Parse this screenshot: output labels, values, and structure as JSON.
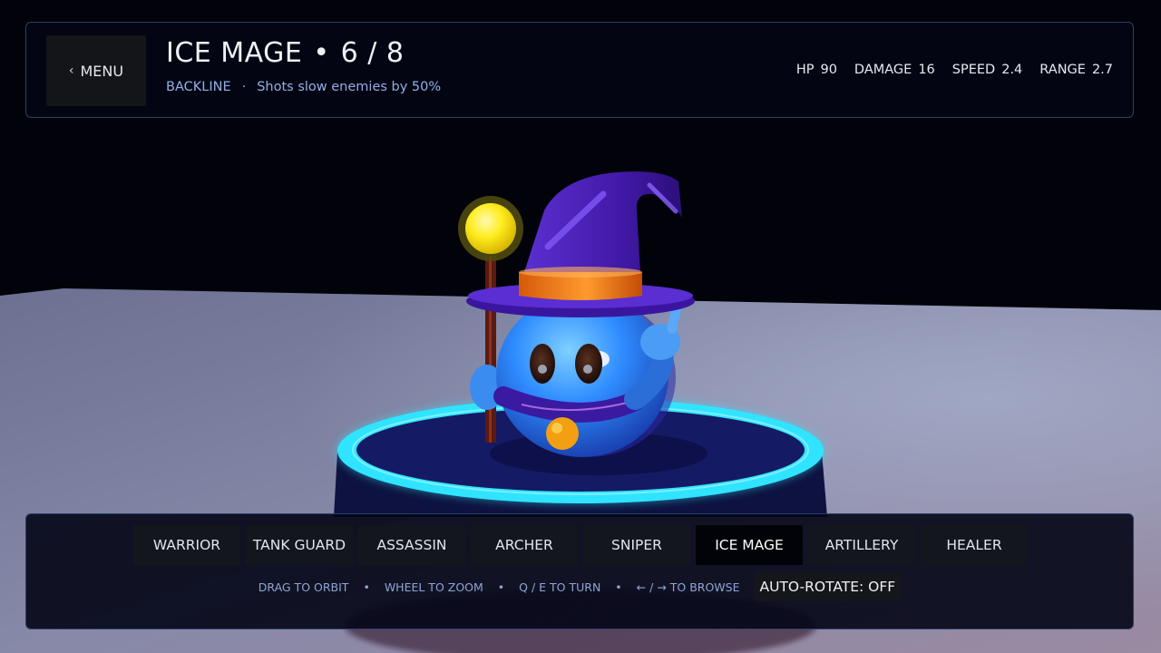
{
  "header": {
    "menu_label": "MENU",
    "menu_icon": "chevron-left-icon",
    "unit_name": "ICE MAGE",
    "title_separator": "•",
    "unit_index": "6 / 8",
    "role": "BACKLINE",
    "sub_separator": "·",
    "ability": "Shots slow enemies by 50%",
    "stats": [
      {
        "label": "HP",
        "value": "90"
      },
      {
        "label": "DAMAGE",
        "value": "16"
      },
      {
        "label": "SPEED",
        "value": "2.4"
      },
      {
        "label": "RANGE",
        "value": "2.7"
      }
    ]
  },
  "unit_tabs": [
    {
      "label": "WARRIOR",
      "active": false
    },
    {
      "label": "TANK GUARD",
      "active": false
    },
    {
      "label": "ASSASSIN",
      "active": false
    },
    {
      "label": "ARCHER",
      "active": false
    },
    {
      "label": "SNIPER",
      "active": false
    },
    {
      "label": "ICE MAGE",
      "active": true
    },
    {
      "label": "ARTILLERY",
      "active": false
    },
    {
      "label": "HEALER",
      "active": false
    }
  ],
  "controls": {
    "hints": [
      "DRAG TO ORBIT",
      "WHEEL TO ZOOM",
      "Q / E TO TURN",
      "← / → TO BROWSE"
    ],
    "separator": "•",
    "auto_rotate_label": "AUTO-ROTATE: OFF"
  },
  "colors": {
    "accent_ring": "#2ee8ff",
    "mage_body": "#2f86ff",
    "hat": "#4a1fb8",
    "hat_band": "#f07a12",
    "orb": "#ffe81a",
    "panel_border": "#2c3f6a"
  }
}
